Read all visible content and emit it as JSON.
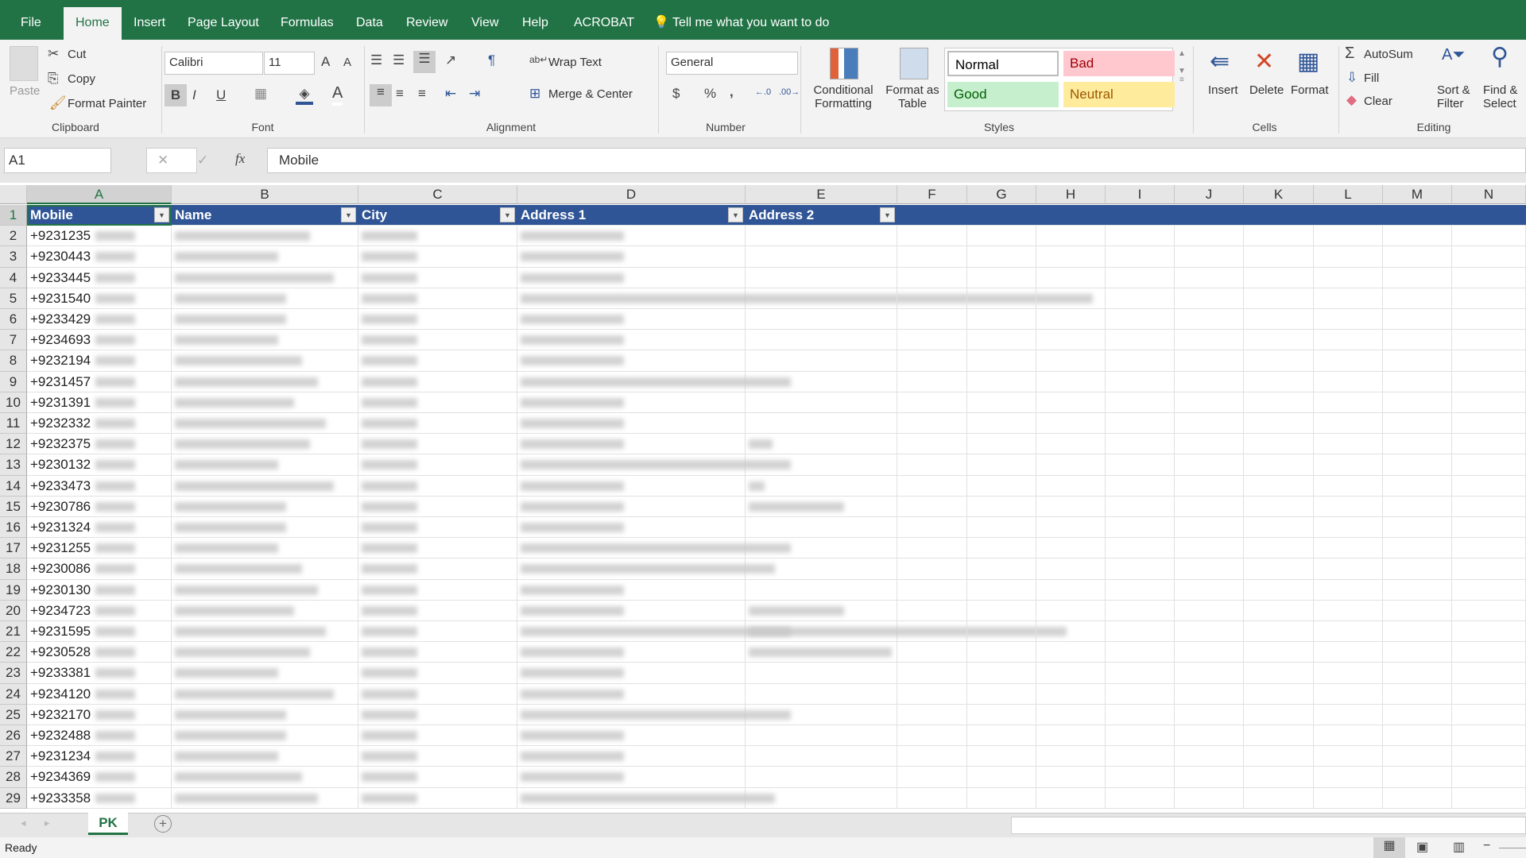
{
  "tabs": [
    "File",
    "Home",
    "Insert",
    "Page Layout",
    "Formulas",
    "Data",
    "Review",
    "View",
    "Help",
    "ACROBAT"
  ],
  "tell_me": "Tell me what you want to do",
  "clipboard": {
    "paste": "Paste",
    "cut": "Cut",
    "copy": "Copy",
    "format_painter": "Format Painter",
    "label": "Clipboard"
  },
  "font": {
    "name": "Calibri",
    "size": "11",
    "bold": "B",
    "italic": "I",
    "underline": "U",
    "label": "Font"
  },
  "alignment": {
    "wrap": "Wrap Text",
    "merge": "Merge & Center",
    "label": "Alignment"
  },
  "number": {
    "format": "General",
    "currency": "$",
    "percent": "%",
    "comma": ",",
    "label": "Number"
  },
  "styles": {
    "conditional": [
      "Conditional",
      "Formatting"
    ],
    "format_table": [
      "Format as",
      "Table"
    ],
    "normal": "Normal",
    "bad": "Bad",
    "good": "Good",
    "neutral": "Neutral",
    "label": "Styles",
    "colors": {
      "bad_bg": "#ffc7ce",
      "bad_fg": "#9c0006",
      "good_bg": "#c6efce",
      "good_fg": "#006100",
      "neutral_bg": "#ffeb9c",
      "neutral_fg": "#9c5700"
    }
  },
  "cells": {
    "insert": "Insert",
    "delete": "Delete",
    "format": "Format",
    "label": "Cells"
  },
  "editing": {
    "autosum": "AutoSum",
    "fill": "Fill",
    "clear": "Clear",
    "sort": [
      "Sort &",
      "Filter"
    ],
    "find": [
      "Find &",
      "Select"
    ],
    "label": "Editing"
  },
  "formula_bar": {
    "name_box": "A1",
    "fx": "fx",
    "value": "Mobile"
  },
  "columns": [
    "A",
    "B",
    "C",
    "D",
    "E",
    "F",
    "G",
    "H",
    "I",
    "J",
    "K",
    "L",
    "M",
    "N"
  ],
  "headers": [
    "Mobile",
    "Name",
    "City",
    "Address 1",
    "Address 2"
  ],
  "row_numbers": [
    "1",
    "2",
    "3",
    "4",
    "5",
    "6",
    "7",
    "8",
    "9",
    "10",
    "11",
    "12",
    "13",
    "14",
    "15",
    "16",
    "17",
    "18",
    "19",
    "20",
    "21",
    "22",
    "23",
    "24",
    "25",
    "26",
    "27",
    "28",
    "29"
  ],
  "mobiles": [
    "+9231235",
    "+9230443",
    "+9233445",
    "+9231540",
    "+9233429",
    "+9234693",
    "+9232194",
    "+9231457",
    "+9231391",
    "+9232332",
    "+9232375",
    "+9230132",
    "+9233473",
    "+9230786",
    "+9231324",
    "+9231255",
    "+9230086",
    "+9230130",
    "+9234723",
    "+9231595",
    "+9230528",
    "+9233381",
    "+9234120",
    "+9232170",
    "+9232488",
    "+9231234",
    "+9234369",
    "+9233358"
  ],
  "sheet_tab": "PK",
  "status": "Ready",
  "accent": "#217346",
  "header_fill": "#2f5597"
}
